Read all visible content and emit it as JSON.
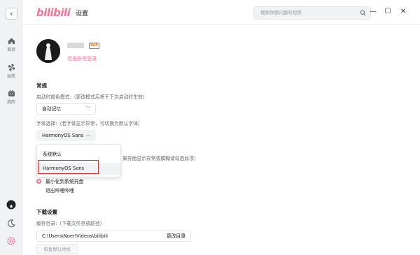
{
  "app": {
    "logo": "bilibili",
    "title": "设置"
  },
  "search": {
    "placeholder": "搜索你感兴趣的视频"
  },
  "window": {
    "minimize": "—",
    "maximize": "☐",
    "close": "✕"
  },
  "sidebar": {
    "back": "‹",
    "items": [
      {
        "label": "首页",
        "icon": "home-icon"
      },
      {
        "label": "动态",
        "icon": "pinwheel-icon"
      },
      {
        "label": "我的",
        "icon": "tv-icon"
      }
    ],
    "bottom_icons": [
      "avatar-icon",
      "theme-moon-icon",
      "settings-gear-icon"
    ]
  },
  "profile": {
    "level": "LV5",
    "logout": "退出账号登录"
  },
  "general": {
    "title": "常规",
    "color_mode_label": "启动时颜色模式:（更改模式后将于下次启动时生效）",
    "color_mode_value": "自动记忆",
    "font_label": "字体选择:（若字体显示异常，可切换为默认字体）",
    "font_value": "HarmonyOS Sans",
    "font_options": [
      "系统默认",
      "HarmonyOS Sans"
    ],
    "hidden_option_text": "果界面显示异常或模糊请勾选此项)",
    "close_options": [
      "最小化到系统托盘",
      "退出哔哩哔哩"
    ]
  },
  "download": {
    "title": "下载设置",
    "cache_label": "缓存目录:（下载文件存放路径）",
    "path": "C:\\Users\\Noer\\Videos\\bilibili",
    "change_button": "更改目录",
    "reset_button": "恢复默认地址"
  },
  "colors": {
    "accent": "#fb7299",
    "highlight": "#e03131"
  }
}
